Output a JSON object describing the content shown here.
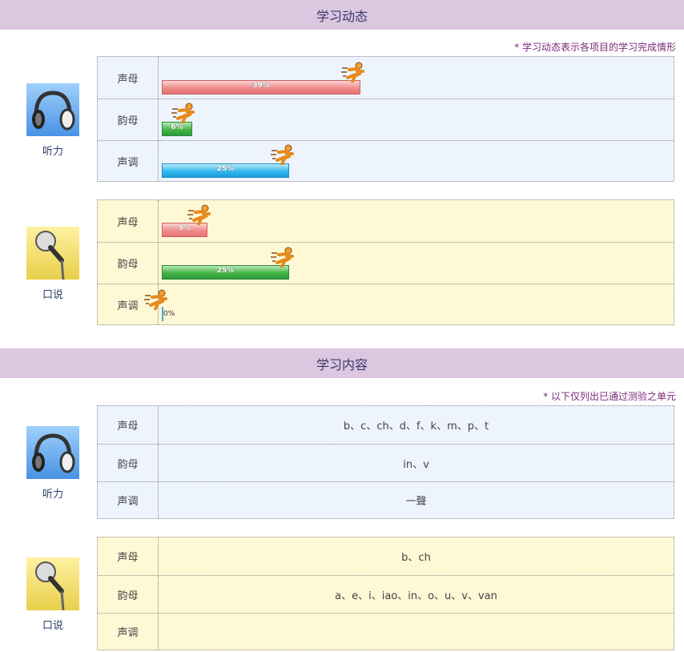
{
  "dynamics": {
    "title": "学习动态",
    "note": "* 学习动态表示各项目的学习完成情形",
    "groups": [
      {
        "name": "听力",
        "icon": "headphones-icon",
        "theme": "blue",
        "rows": [
          {
            "label": "声母",
            "percent": "39%",
            "value": 0.39,
            "color": "red"
          },
          {
            "label": "韵母",
            "percent": "6%",
            "value": 0.06,
            "color": "green"
          },
          {
            "label": "声调",
            "percent": "25%",
            "value": 0.25,
            "color": "blue"
          }
        ]
      },
      {
        "name": "口说",
        "icon": "microphone-icon",
        "theme": "yellow",
        "rows": [
          {
            "label": "声母",
            "percent": "9%",
            "value": 0.09,
            "color": "red"
          },
          {
            "label": "韵母",
            "percent": "25%",
            "value": 0.25,
            "color": "green"
          },
          {
            "label": "声调",
            "percent": "0%",
            "value": 0.0,
            "color": "blue"
          }
        ]
      }
    ]
  },
  "content": {
    "title": "学习内容",
    "note": "* 以下仅列出已通过测验之单元",
    "groups": [
      {
        "name": "听力",
        "icon": "headphones-icon",
        "theme": "blue",
        "rows": [
          {
            "label": "声母",
            "value": "b、c、ch、d、f、k、m、p、t"
          },
          {
            "label": "韵母",
            "value": "in、v"
          },
          {
            "label": "声调",
            "value": "一聲"
          }
        ]
      },
      {
        "name": "口说",
        "icon": "microphone-icon",
        "theme": "yellow",
        "rows": [
          {
            "label": "声母",
            "value": "b、ch"
          },
          {
            "label": "韵母",
            "value": "a、e、i、iao、in、o、u、v、van"
          },
          {
            "label": "声调",
            "value": ""
          }
        ]
      }
    ]
  },
  "colors": {
    "header_bg": "#dcc6e0",
    "note": "#7a2a7a",
    "blue_panel": "#edf4fd",
    "yellow_panel": "#fef8d5"
  }
}
